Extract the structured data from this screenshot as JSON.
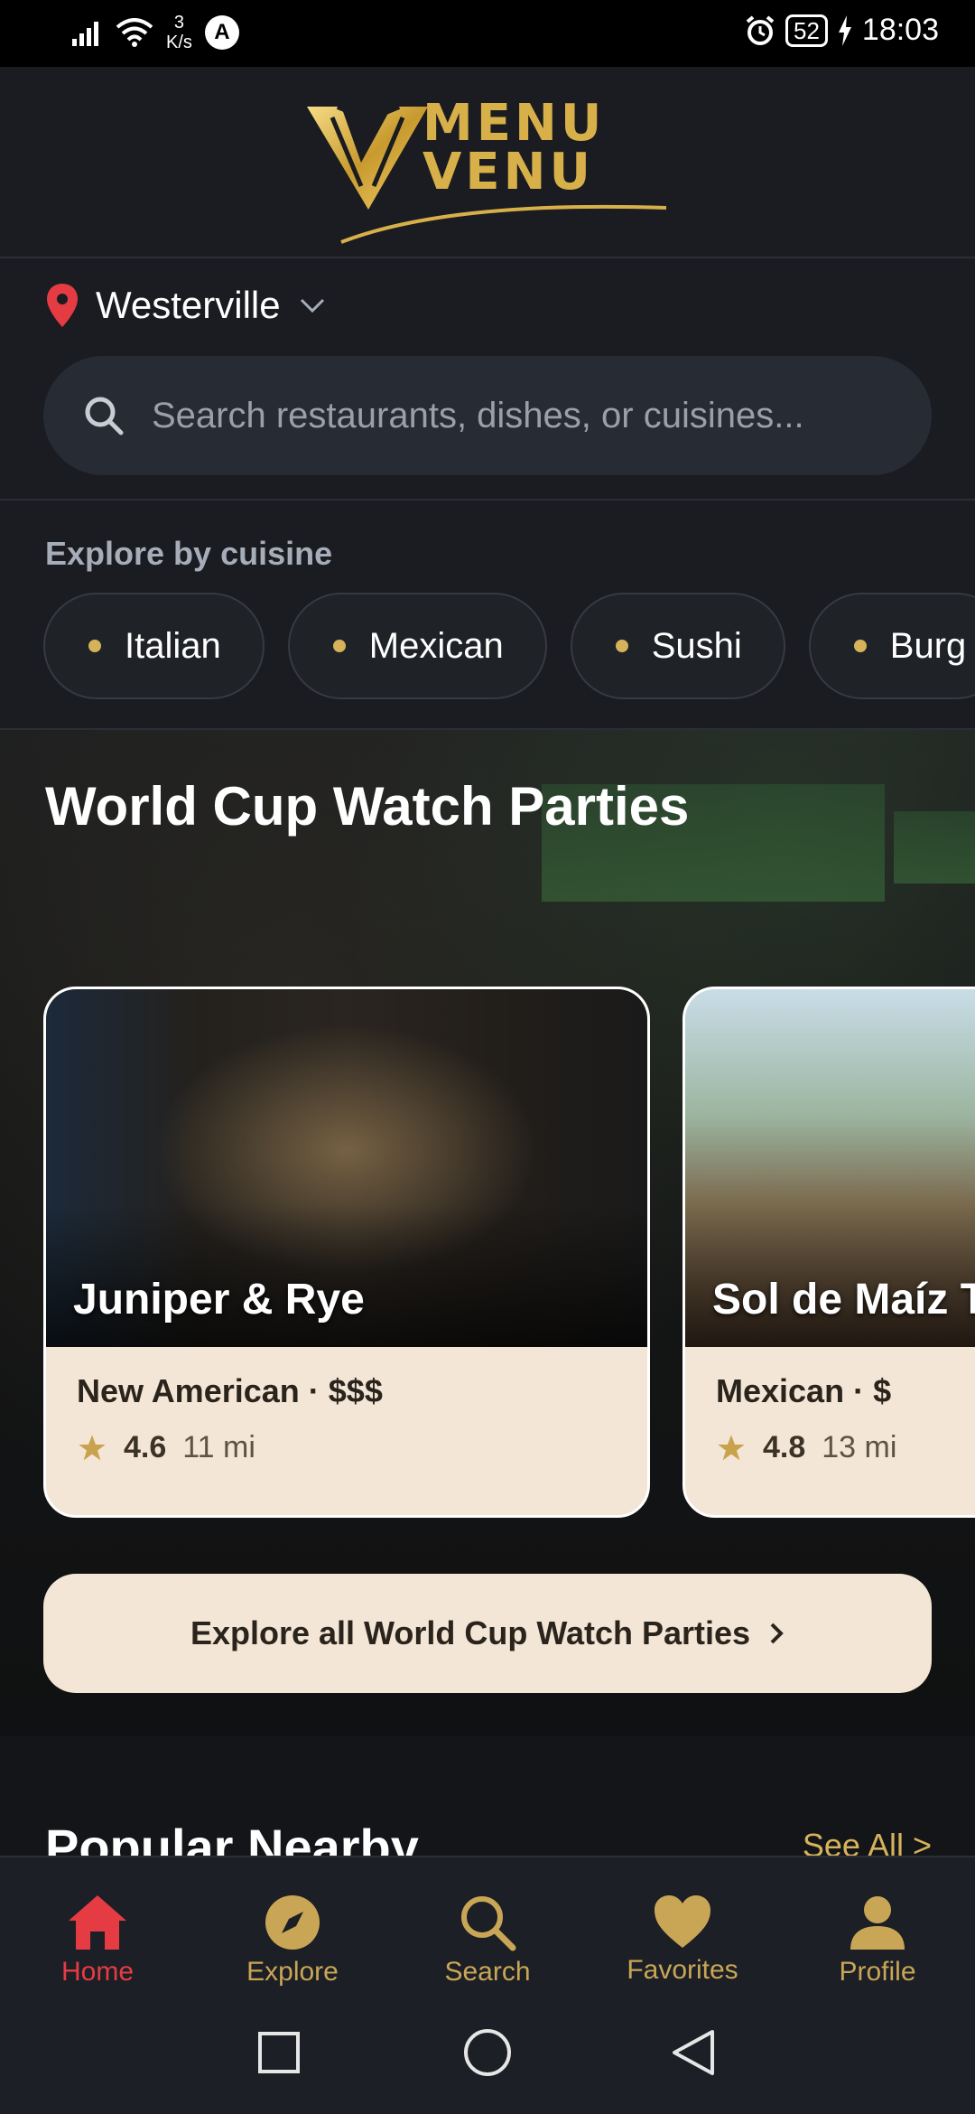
{
  "status_bar": {
    "net_speed_value": "3",
    "net_speed_unit": "K/s",
    "vpn_letter": "A",
    "battery": "52",
    "time": "18:03"
  },
  "logo": {
    "line1": "MENU",
    "line2": "VENU"
  },
  "location": {
    "city": "Westerville"
  },
  "search": {
    "placeholder": "Search restaurants, dishes, or cuisines..."
  },
  "cuisine": {
    "title": "Explore by cuisine",
    "chips": [
      "Italian",
      "Mexican",
      "Sushi",
      "Burg"
    ]
  },
  "watch_parties": {
    "title": "World Cup Watch Parties",
    "cards": [
      {
        "name": "Juniper & Rye",
        "cuisine": "New American",
        "price": "$$$",
        "rating": "4.6",
        "distance": "11 mi"
      },
      {
        "name": "Sol de Maíz T",
        "cuisine": "Mexican",
        "price": "$",
        "rating": "4.8",
        "distance": "13 mi"
      }
    ],
    "explore_label": "Explore all World Cup Watch Parties"
  },
  "popular": {
    "title": "Popular Nearby",
    "see_all": "See All >"
  },
  "nav": {
    "items": [
      {
        "label": "Home",
        "icon": "home-icon"
      },
      {
        "label": "Explore",
        "icon": "compass-icon"
      },
      {
        "label": "Search",
        "icon": "search-icon"
      },
      {
        "label": "Favorites",
        "icon": "heart-icon"
      },
      {
        "label": "Profile",
        "icon": "person-icon"
      }
    ]
  },
  "colors": {
    "accent_gold": "#d6b35a",
    "active_red": "#e53c44",
    "card_cream": "#f3e6d6",
    "background": "#131519"
  }
}
